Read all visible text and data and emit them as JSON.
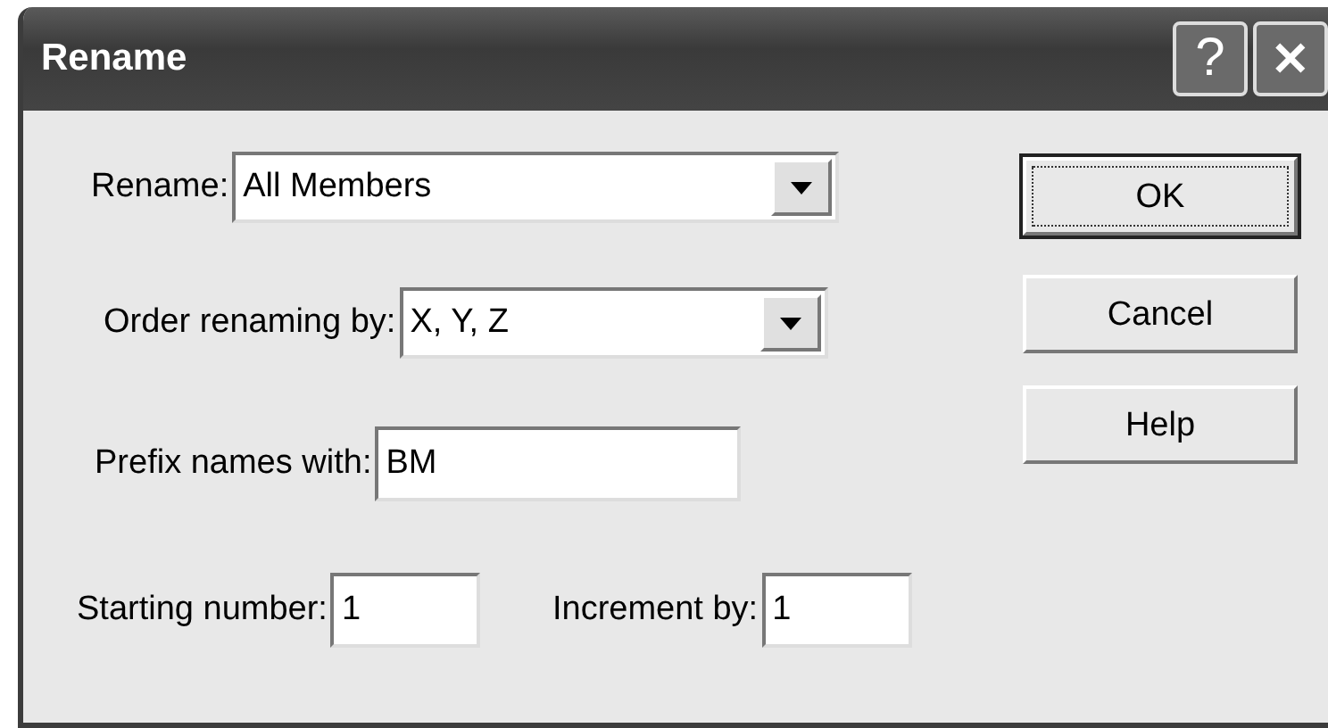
{
  "window": {
    "title": "Rename",
    "title_buttons": [
      {
        "kind": "help",
        "label": "?"
      },
      {
        "kind": "close",
        "label": "✕"
      }
    ]
  },
  "rows": [
    {
      "fields": [
        {
          "label": "Rename:",
          "kind": "dropdown",
          "value": "All Members"
        }
      ]
    },
    {
      "fields": [
        {
          "label": "Order renaming by:",
          "kind": "dropdown",
          "value": "X, Y, Z"
        }
      ]
    },
    {
      "fields": [
        {
          "label": "Prefix names with:",
          "kind": "text",
          "value": "BM"
        }
      ]
    },
    {
      "fields": [
        {
          "label": "Starting number:",
          "kind": "short",
          "value": "1"
        },
        {
          "label": "Increment by:",
          "kind": "short",
          "value": "1"
        }
      ]
    }
  ],
  "buttons": [
    {
      "label": "OK",
      "default": true
    },
    {
      "label": "Cancel",
      "default": false
    },
    {
      "label": "Help",
      "default": false
    }
  ]
}
